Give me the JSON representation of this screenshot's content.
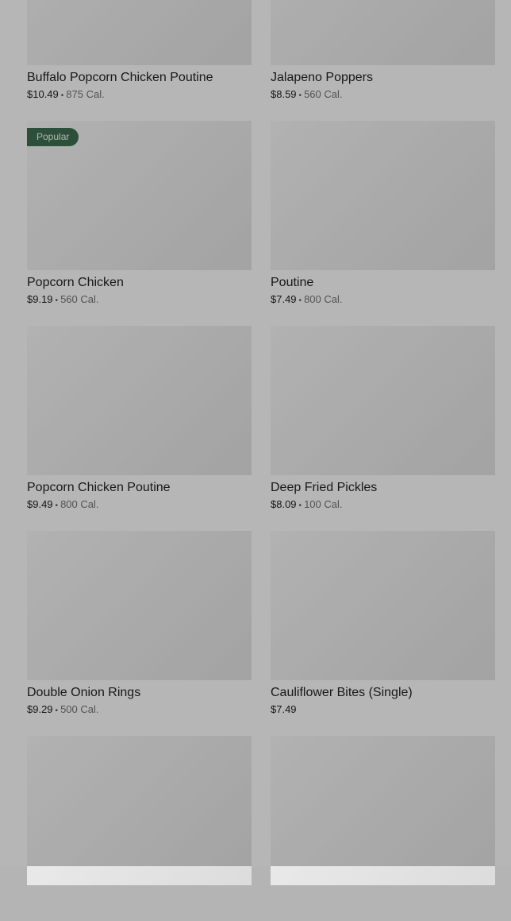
{
  "menu": {
    "badge_label": "Popular",
    "items": [
      {
        "name": "Buffalo Popcorn Chicken Poutine",
        "price": "$10.49",
        "calories": "875 Cal."
      },
      {
        "name": "Jalapeno Poppers",
        "price": "$8.59",
        "calories": "560 Cal."
      },
      {
        "name": "Popcorn Chicken",
        "price": "$9.19",
        "calories": "560 Cal.",
        "popular": true
      },
      {
        "name": "Poutine",
        "price": "$7.49",
        "calories": "800 Cal."
      },
      {
        "name": "Popcorn Chicken Poutine",
        "price": "$9.49",
        "calories": "800 Cal."
      },
      {
        "name": "Deep Fried Pickles",
        "price": "$8.09",
        "calories": "100 Cal."
      },
      {
        "name": "Double Onion Rings",
        "price": "$9.29",
        "calories": "500 Cal."
      },
      {
        "name": "Cauliflower Bites (Single)",
        "price": "$7.49",
        "calories": ""
      }
    ]
  },
  "colors": {
    "badge_bg": "#3b6b4d",
    "overlay": "rgba(0,0,0,0.26)"
  }
}
